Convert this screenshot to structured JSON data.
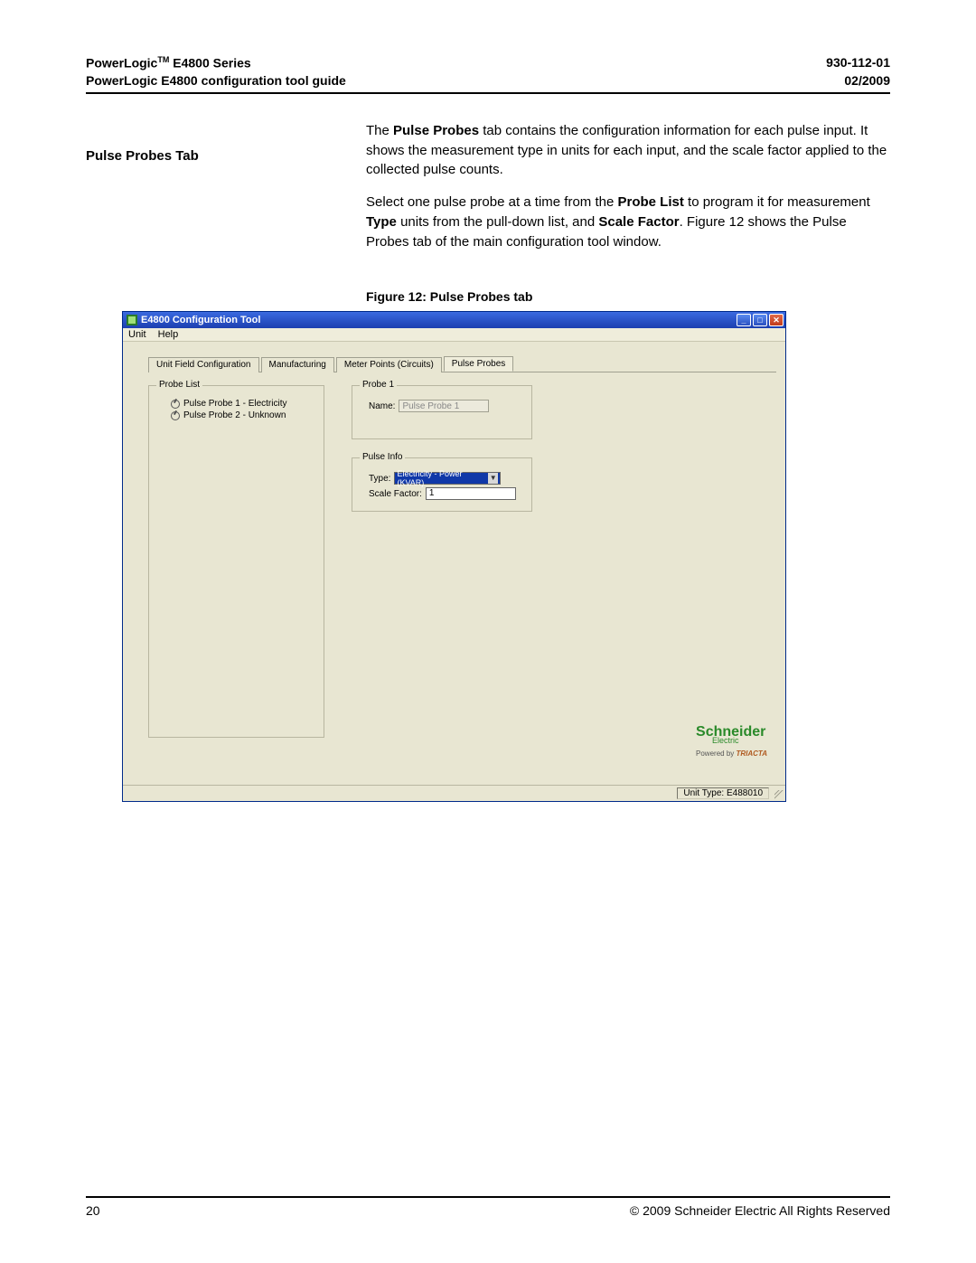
{
  "header": {
    "product_line1_a": "PowerLogic",
    "product_line1_tm": "TM",
    "product_line1_b": " E4800 Series",
    "product_line2": "PowerLogic E4800 configuration tool guide",
    "docnum": "930-112-01",
    "date": "02/2009"
  },
  "section": {
    "title": "Pulse Probes Tab",
    "para1_a": "The ",
    "para1_b": "Pulse Probes",
    "para1_c": " tab contains the configuration information for each pulse input. It shows the measurement type in units for each input, and the scale factor applied to the collected pulse counts.",
    "para2_a": "Select one pulse probe at a time from the ",
    "para2_b": "Probe List",
    "para2_c": " to program it for measurement ",
    "para2_d": "Type",
    "para2_e": " units from the pull-down list, and ",
    "para2_f": "Scale Factor",
    "para2_g": ". Figure 12 shows the Pulse Probes tab of the main configuration tool window.",
    "figcaption": "Figure 12:  Pulse Probes tab"
  },
  "app": {
    "title": "E4800 Configuration Tool",
    "menu": {
      "unit": "Unit",
      "help": "Help"
    },
    "tabs": {
      "t1": "Unit Field Configuration",
      "t2": "Manufacturing",
      "t3": "Meter Points (Circuits)",
      "t4": "Pulse Probes"
    },
    "probe_list": {
      "legend": "Probe List",
      "items": [
        "Pulse Probe 1 - Electricity",
        "Pulse Probe 2 - Unknown"
      ]
    },
    "probe1": {
      "legend": "Probe 1",
      "name_label": "Name:",
      "name_value": "Pulse Probe 1"
    },
    "pulseinfo": {
      "legend": "Pulse Info",
      "type_label": "Type:",
      "type_value": "Electricity - Power (KVAR)",
      "scale_label": "Scale Factor:",
      "scale_value": "1"
    },
    "brand": {
      "schneider": "Schneider",
      "electric": "Electric",
      "powered_prefix": "Powered by ",
      "triacta": "TRIACTA"
    },
    "status": {
      "unit_type": "Unit Type: E488010"
    },
    "winbtn": {
      "min": "_",
      "max": "□",
      "close": "✕"
    }
  },
  "footer": {
    "page": "20",
    "copyright": "© 2009 Schneider Electric All Rights Reserved"
  }
}
